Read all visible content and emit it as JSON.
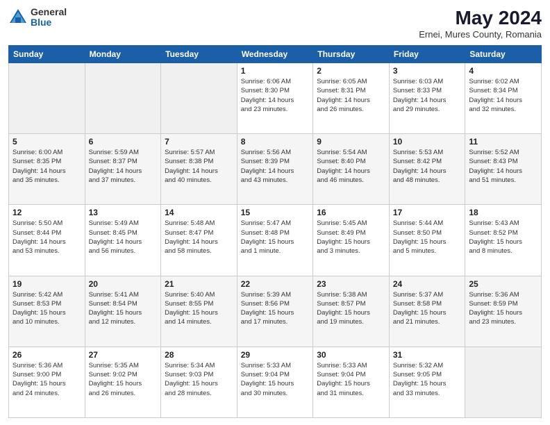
{
  "logo": {
    "general": "General",
    "blue": "Blue"
  },
  "title": "May 2024",
  "subtitle": "Ernei, Mures County, Romania",
  "days_of_week": [
    "Sunday",
    "Monday",
    "Tuesday",
    "Wednesday",
    "Thursday",
    "Friday",
    "Saturday"
  ],
  "weeks": [
    [
      {
        "day": "",
        "info": ""
      },
      {
        "day": "",
        "info": ""
      },
      {
        "day": "",
        "info": ""
      },
      {
        "day": "1",
        "info": "Sunrise: 6:06 AM\nSunset: 8:30 PM\nDaylight: 14 hours\nand 23 minutes."
      },
      {
        "day": "2",
        "info": "Sunrise: 6:05 AM\nSunset: 8:31 PM\nDaylight: 14 hours\nand 26 minutes."
      },
      {
        "day": "3",
        "info": "Sunrise: 6:03 AM\nSunset: 8:33 PM\nDaylight: 14 hours\nand 29 minutes."
      },
      {
        "day": "4",
        "info": "Sunrise: 6:02 AM\nSunset: 8:34 PM\nDaylight: 14 hours\nand 32 minutes."
      }
    ],
    [
      {
        "day": "5",
        "info": "Sunrise: 6:00 AM\nSunset: 8:35 PM\nDaylight: 14 hours\nand 35 minutes."
      },
      {
        "day": "6",
        "info": "Sunrise: 5:59 AM\nSunset: 8:37 PM\nDaylight: 14 hours\nand 37 minutes."
      },
      {
        "day": "7",
        "info": "Sunrise: 5:57 AM\nSunset: 8:38 PM\nDaylight: 14 hours\nand 40 minutes."
      },
      {
        "day": "8",
        "info": "Sunrise: 5:56 AM\nSunset: 8:39 PM\nDaylight: 14 hours\nand 43 minutes."
      },
      {
        "day": "9",
        "info": "Sunrise: 5:54 AM\nSunset: 8:40 PM\nDaylight: 14 hours\nand 46 minutes."
      },
      {
        "day": "10",
        "info": "Sunrise: 5:53 AM\nSunset: 8:42 PM\nDaylight: 14 hours\nand 48 minutes."
      },
      {
        "day": "11",
        "info": "Sunrise: 5:52 AM\nSunset: 8:43 PM\nDaylight: 14 hours\nand 51 minutes."
      }
    ],
    [
      {
        "day": "12",
        "info": "Sunrise: 5:50 AM\nSunset: 8:44 PM\nDaylight: 14 hours\nand 53 minutes."
      },
      {
        "day": "13",
        "info": "Sunrise: 5:49 AM\nSunset: 8:45 PM\nDaylight: 14 hours\nand 56 minutes."
      },
      {
        "day": "14",
        "info": "Sunrise: 5:48 AM\nSunset: 8:47 PM\nDaylight: 14 hours\nand 58 minutes."
      },
      {
        "day": "15",
        "info": "Sunrise: 5:47 AM\nSunset: 8:48 PM\nDaylight: 15 hours\nand 1 minute."
      },
      {
        "day": "16",
        "info": "Sunrise: 5:45 AM\nSunset: 8:49 PM\nDaylight: 15 hours\nand 3 minutes."
      },
      {
        "day": "17",
        "info": "Sunrise: 5:44 AM\nSunset: 8:50 PM\nDaylight: 15 hours\nand 5 minutes."
      },
      {
        "day": "18",
        "info": "Sunrise: 5:43 AM\nSunset: 8:52 PM\nDaylight: 15 hours\nand 8 minutes."
      }
    ],
    [
      {
        "day": "19",
        "info": "Sunrise: 5:42 AM\nSunset: 8:53 PM\nDaylight: 15 hours\nand 10 minutes."
      },
      {
        "day": "20",
        "info": "Sunrise: 5:41 AM\nSunset: 8:54 PM\nDaylight: 15 hours\nand 12 minutes."
      },
      {
        "day": "21",
        "info": "Sunrise: 5:40 AM\nSunset: 8:55 PM\nDaylight: 15 hours\nand 14 minutes."
      },
      {
        "day": "22",
        "info": "Sunrise: 5:39 AM\nSunset: 8:56 PM\nDaylight: 15 hours\nand 17 minutes."
      },
      {
        "day": "23",
        "info": "Sunrise: 5:38 AM\nSunset: 8:57 PM\nDaylight: 15 hours\nand 19 minutes."
      },
      {
        "day": "24",
        "info": "Sunrise: 5:37 AM\nSunset: 8:58 PM\nDaylight: 15 hours\nand 21 minutes."
      },
      {
        "day": "25",
        "info": "Sunrise: 5:36 AM\nSunset: 8:59 PM\nDaylight: 15 hours\nand 23 minutes."
      }
    ],
    [
      {
        "day": "26",
        "info": "Sunrise: 5:36 AM\nSunset: 9:00 PM\nDaylight: 15 hours\nand 24 minutes."
      },
      {
        "day": "27",
        "info": "Sunrise: 5:35 AM\nSunset: 9:02 PM\nDaylight: 15 hours\nand 26 minutes."
      },
      {
        "day": "28",
        "info": "Sunrise: 5:34 AM\nSunset: 9:03 PM\nDaylight: 15 hours\nand 28 minutes."
      },
      {
        "day": "29",
        "info": "Sunrise: 5:33 AM\nSunset: 9:04 PM\nDaylight: 15 hours\nand 30 minutes."
      },
      {
        "day": "30",
        "info": "Sunrise: 5:33 AM\nSunset: 9:04 PM\nDaylight: 15 hours\nand 31 minutes."
      },
      {
        "day": "31",
        "info": "Sunrise: 5:32 AM\nSunset: 9:05 PM\nDaylight: 15 hours\nand 33 minutes."
      },
      {
        "day": "",
        "info": ""
      }
    ]
  ]
}
